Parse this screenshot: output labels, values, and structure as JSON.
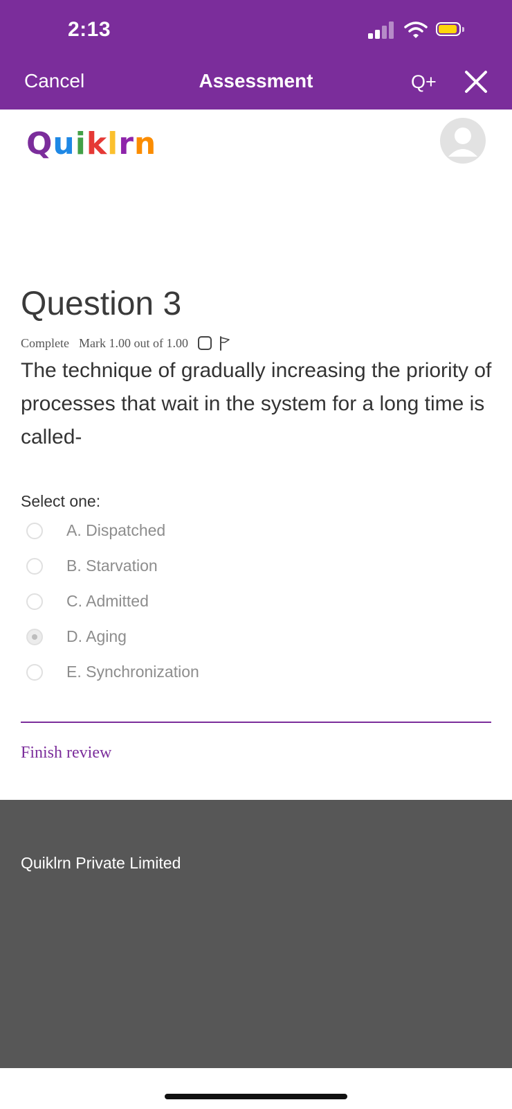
{
  "status_bar": {
    "time": "2:13",
    "battery_color": "#ffd60a",
    "icons": [
      "signal-icon",
      "wifi-icon",
      "battery-icon"
    ]
  },
  "nav": {
    "cancel_label": "Cancel",
    "title": "Assessment",
    "qplus_label": "Q+",
    "close_icon": "close-icon"
  },
  "brand": {
    "logo_letters": [
      "Q",
      "u",
      "i",
      "k",
      "l",
      "r",
      "n"
    ],
    "avatar_icon": "user-avatar-icon"
  },
  "question": {
    "title": "Question 3",
    "state": "Complete",
    "mark": "Mark 1.00 out of 1.00",
    "text": "The technique of gradually increasing the priority of processes that wait in the system for a long time is called-",
    "select_label": "Select one:",
    "options": [
      {
        "label": "A. Dispatched",
        "selected": false
      },
      {
        "label": "B. Starvation",
        "selected": false
      },
      {
        "label": "C. Admitted",
        "selected": false
      },
      {
        "label": "D. Aging",
        "selected": true
      },
      {
        "label": "E. Synchronization",
        "selected": false
      }
    ]
  },
  "actions": {
    "finish_review": "Finish review"
  },
  "footer": {
    "company": "Quiklrn Private Limited"
  },
  "colors": {
    "brand_purple": "#7b2d9b",
    "footer_gray": "#575757"
  }
}
